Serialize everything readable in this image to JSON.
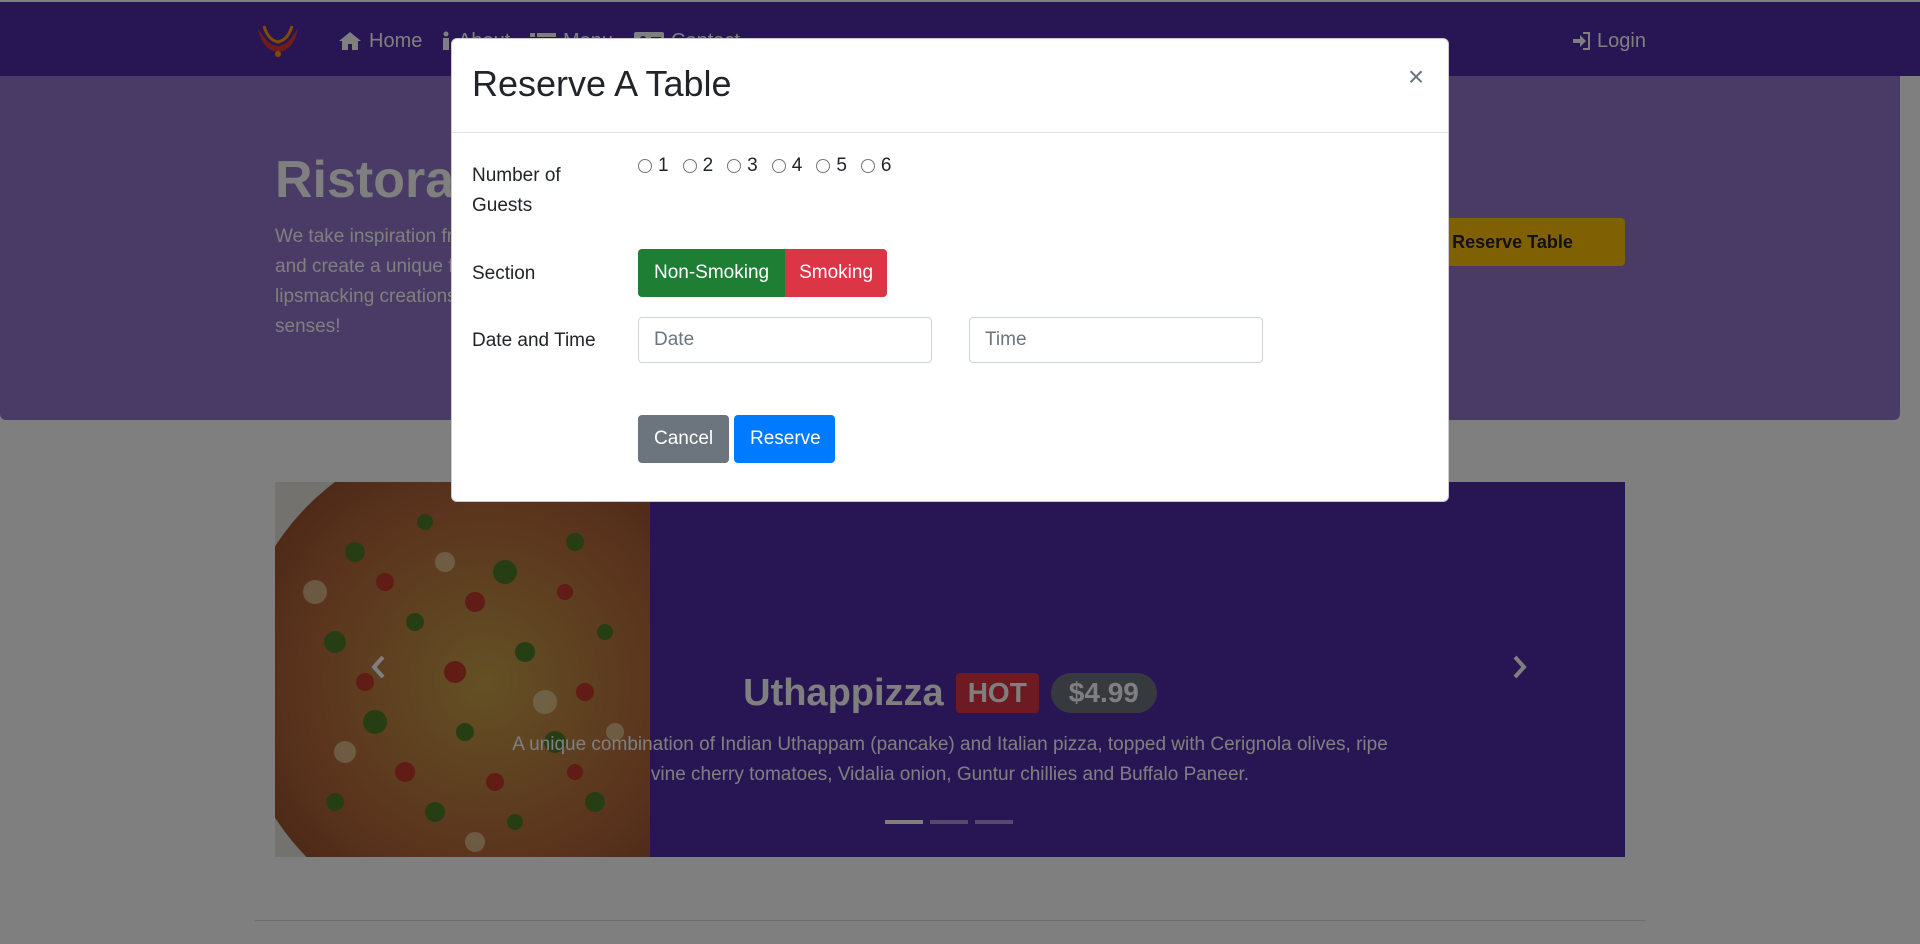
{
  "navbar": {
    "items": [
      {
        "label": "Home",
        "icon": "home-icon"
      },
      {
        "label": "About",
        "icon": "info-icon"
      },
      {
        "label": "Menu",
        "icon": "list-icon"
      },
      {
        "label": "Contact",
        "icon": "address-card-icon"
      }
    ],
    "login": {
      "label": "Login",
      "icon": "sign-in-icon"
    }
  },
  "jumbotron": {
    "title": "Ristorante Con Fusion",
    "text": "We take inspiration from the World's best cuisines, and create a unique fusion experience. Our lipsmacking creations will tickle your culinary senses!",
    "reserve_button": "Reserve Table"
  },
  "carousel": {
    "title": "Uthappizza",
    "badge": "HOT",
    "price": "$4.99",
    "description": "A unique combination of Indian Uthappam (pancake) and Italian pizza, topped with Cerignola olives, ripe vine cherry tomatoes, Vidalia onion, Guntur chillies and Buffalo Paneer.",
    "slides": 3,
    "active_slide": 0
  },
  "modal": {
    "title": "Reserve A Table",
    "close_label": "×",
    "guests": {
      "label": "Number of Guests",
      "options": [
        "1",
        "2",
        "3",
        "4",
        "5",
        "6"
      ]
    },
    "section": {
      "label": "Section",
      "options": [
        "Non-Smoking",
        "Smoking"
      ]
    },
    "datetime": {
      "label": "Date and Time",
      "date_placeholder": "Date",
      "time_placeholder": "Time"
    },
    "cancel_label": "Cancel",
    "reserve_label": "Reserve"
  },
  "colors": {
    "primary_dark": "#512da8",
    "primary_light": "#9575cd",
    "warning": "#ffc107",
    "success": "#1e7e34",
    "danger": "#dc3545",
    "secondary": "#6c757d",
    "primary": "#007bff"
  }
}
